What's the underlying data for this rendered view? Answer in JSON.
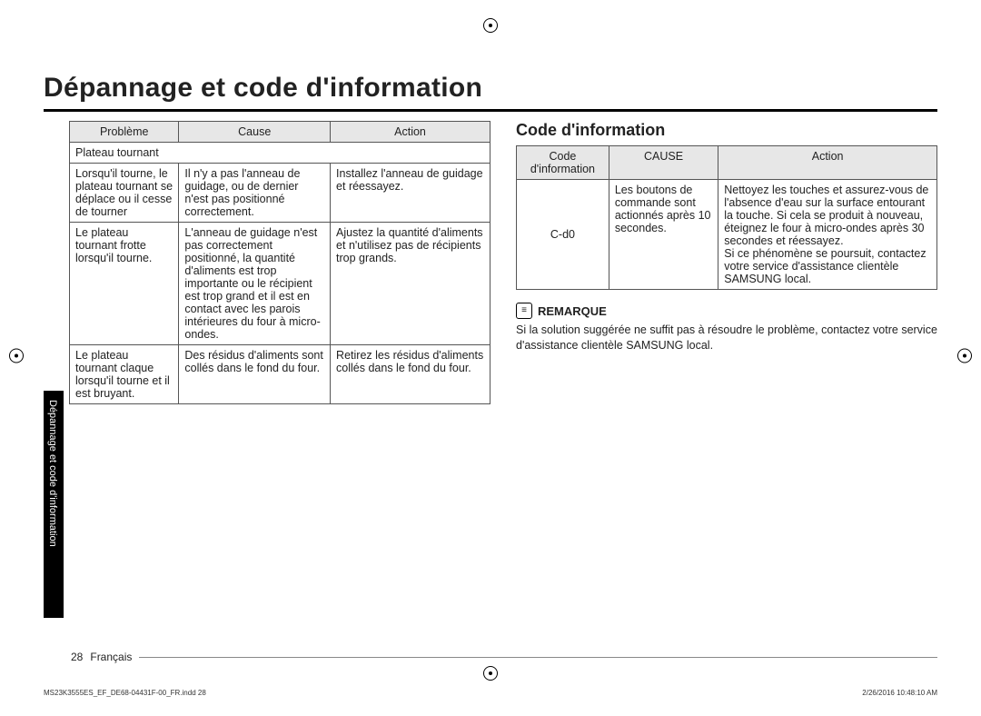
{
  "title": "Dépannage et code d'information",
  "left_table": {
    "headers": [
      "Problème",
      "Cause",
      "Action"
    ],
    "category": "Plateau tournant",
    "rows": [
      {
        "problem": "Lorsqu'il tourne, le plateau tournant se déplace ou il cesse de tourner",
        "cause": "Il n'y a pas l'anneau de guidage, ou de dernier n'est pas positionné correctement.",
        "action": "Installez l'anneau de guidage et réessayez."
      },
      {
        "problem": "Le plateau tournant frotte lorsqu'il tourne.",
        "cause": "L'anneau de guidage n'est pas correctement positionné, la quantité d'aliments est trop importante ou le récipient est trop grand et il est en contact avec les parois intérieures du four à micro-ondes.",
        "action": "Ajustez la quantité d'aliments et n'utilisez pas de récipients trop grands."
      },
      {
        "problem": "Le plateau tournant claque lorsqu'il tourne et il est bruyant.",
        "cause": "Des résidus d'aliments sont collés dans le fond du four.",
        "action": "Retirez les résidus d'aliments collés dans le fond du four."
      }
    ]
  },
  "right_section": {
    "heading": "Code d'information",
    "headers": [
      "Code d'information",
      "CAUSE",
      "Action"
    ],
    "row": {
      "code": "C-d0",
      "cause": "Les boutons de commande sont actionnés après 10 secondes.",
      "action": "Nettoyez les touches et assurez-vous de l'absence d'eau sur la surface entourant la touche. Si cela se produit à nouveau, éteignez le four à micro-ondes après 30 secondes et réessayez.\nSi ce phénomène se poursuit, contactez votre service d'assistance clientèle SAMSUNG local."
    }
  },
  "note": {
    "label": "REMARQUE",
    "text": "Si la solution suggérée ne suffit pas à résoudre le problème, contactez votre service d'assistance clientèle SAMSUNG local."
  },
  "sidebar_label": "Dépannage et code d'information",
  "footer": {
    "page_number": "28",
    "language": "Français",
    "doc_ref": "MS23K3555ES_EF_DE68-04431F-00_FR.indd   28",
    "timestamp": "2/26/2016   10:48:10 AM"
  }
}
